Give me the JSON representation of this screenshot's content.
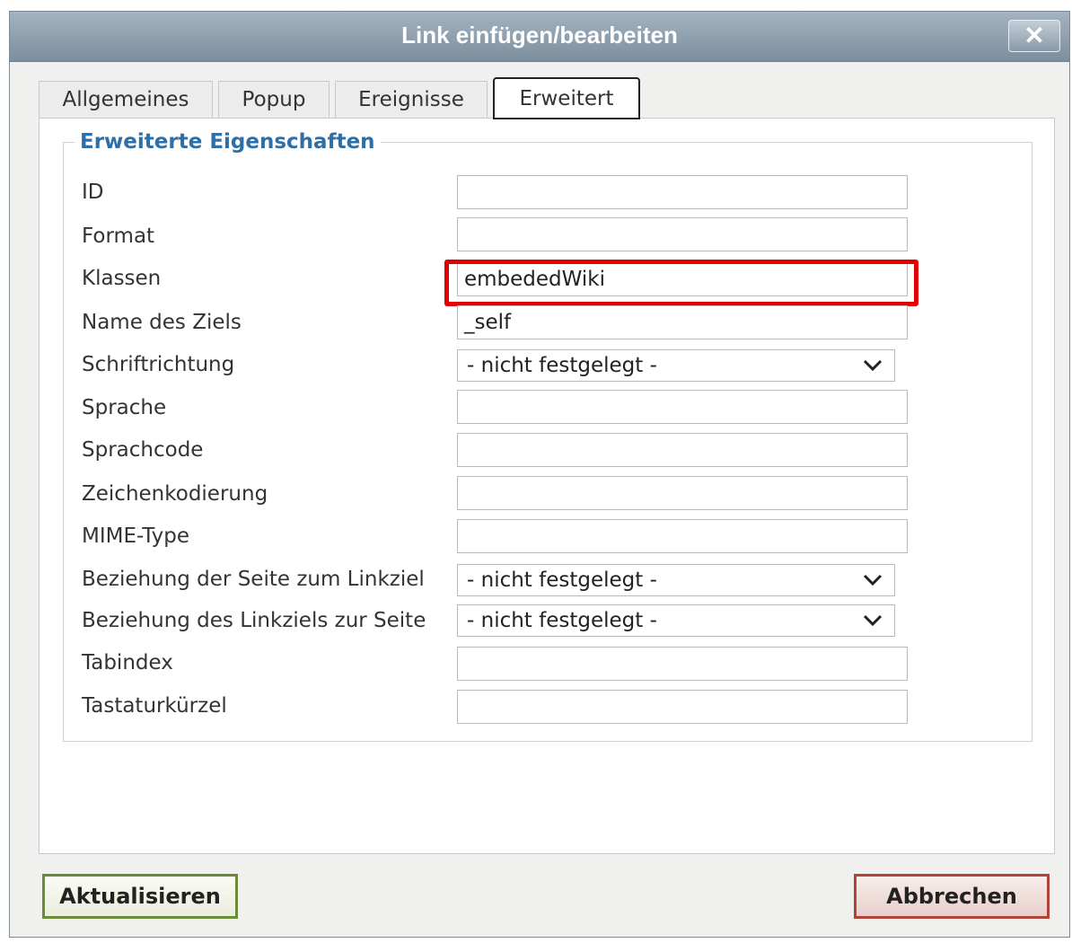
{
  "dialog": {
    "title": "Link einfügen/bearbeiten",
    "close_label": "✕"
  },
  "tabs": [
    {
      "label": "Allgemeines",
      "active": false
    },
    {
      "label": "Popup",
      "active": false
    },
    {
      "label": "Ereignisse",
      "active": false
    },
    {
      "label": "Erweitert",
      "active": true
    }
  ],
  "section": {
    "legend": "Erweiterte Eigenschaften"
  },
  "fields": {
    "id": {
      "label": "ID",
      "value": ""
    },
    "format": {
      "label": "Format",
      "value": ""
    },
    "klassen": {
      "label": "Klassen",
      "value": "embededWiki"
    },
    "name_des_ziels": {
      "label": "Name des Ziels",
      "value": "_self"
    },
    "schriftrichtung": {
      "label": "Schriftrichtung",
      "value": "- nicht festgelegt -"
    },
    "sprache": {
      "label": "Sprache",
      "value": ""
    },
    "sprachcode": {
      "label": "Sprachcode",
      "value": ""
    },
    "zeichenkodierung": {
      "label": "Zeichenkodierung",
      "value": ""
    },
    "mime_type": {
      "label": "MIME-Type",
      "value": ""
    },
    "rel": {
      "label": "Beziehung der Seite zum Linkziel",
      "value": "- nicht festgelegt -"
    },
    "rev": {
      "label": "Beziehung des Linkziels zur Seite",
      "value": "- nicht festgelegt -"
    },
    "tabindex": {
      "label": "Tabindex",
      "value": ""
    },
    "tastaturkuerzel": {
      "label": "Tastaturkürzel",
      "value": ""
    }
  },
  "buttons": {
    "update": "Aktualisieren",
    "cancel": "Abbrechen"
  },
  "colors": {
    "highlight": "#e30000",
    "legend": "#2f6fa7",
    "titlebar": "#8a9bab"
  },
  "icons": {
    "close": "close-icon",
    "dropdown": "chevron-down-icon"
  }
}
